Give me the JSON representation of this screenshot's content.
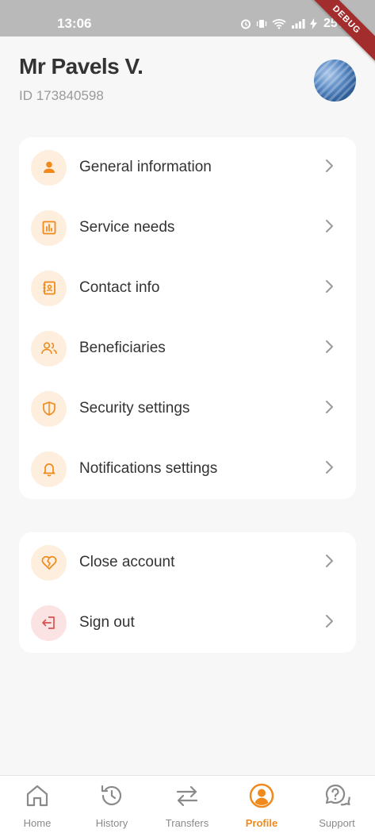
{
  "status_bar": {
    "time": "13:06",
    "battery": "25%",
    "debug_label": "DEBUG"
  },
  "header": {
    "name": "Mr Pavels V.",
    "id_text": "ID 173840598"
  },
  "menu": [
    {
      "label": "General information",
      "icon": "person-icon"
    },
    {
      "label": "Service needs",
      "icon": "bar-chart-icon"
    },
    {
      "label": "Contact info",
      "icon": "contact-book-icon"
    },
    {
      "label": "Beneficiaries",
      "icon": "people-icon"
    },
    {
      "label": "Security settings",
      "icon": "shield-icon"
    },
    {
      "label": "Notifications settings",
      "icon": "bell-icon"
    }
  ],
  "account_menu": [
    {
      "label": "Close account",
      "icon": "broken-heart-icon"
    },
    {
      "label": "Sign out",
      "icon": "sign-out-icon"
    }
  ],
  "bottom_nav": [
    {
      "label": "Home",
      "icon": "home-icon",
      "active": false
    },
    {
      "label": "History",
      "icon": "history-icon",
      "active": false
    },
    {
      "label": "Transfers",
      "icon": "transfer-arrows-icon",
      "active": false
    },
    {
      "label": "Profile",
      "icon": "profile-icon",
      "active": true
    },
    {
      "label": "Support",
      "icon": "support-chat-icon",
      "active": false
    }
  ],
  "colors": {
    "accent": "#f08a1c",
    "accent_bg": "#fdeedd",
    "danger": "#d9534f",
    "danger_bg": "#fbe3e3",
    "page_bg": "#f7f7f7"
  }
}
